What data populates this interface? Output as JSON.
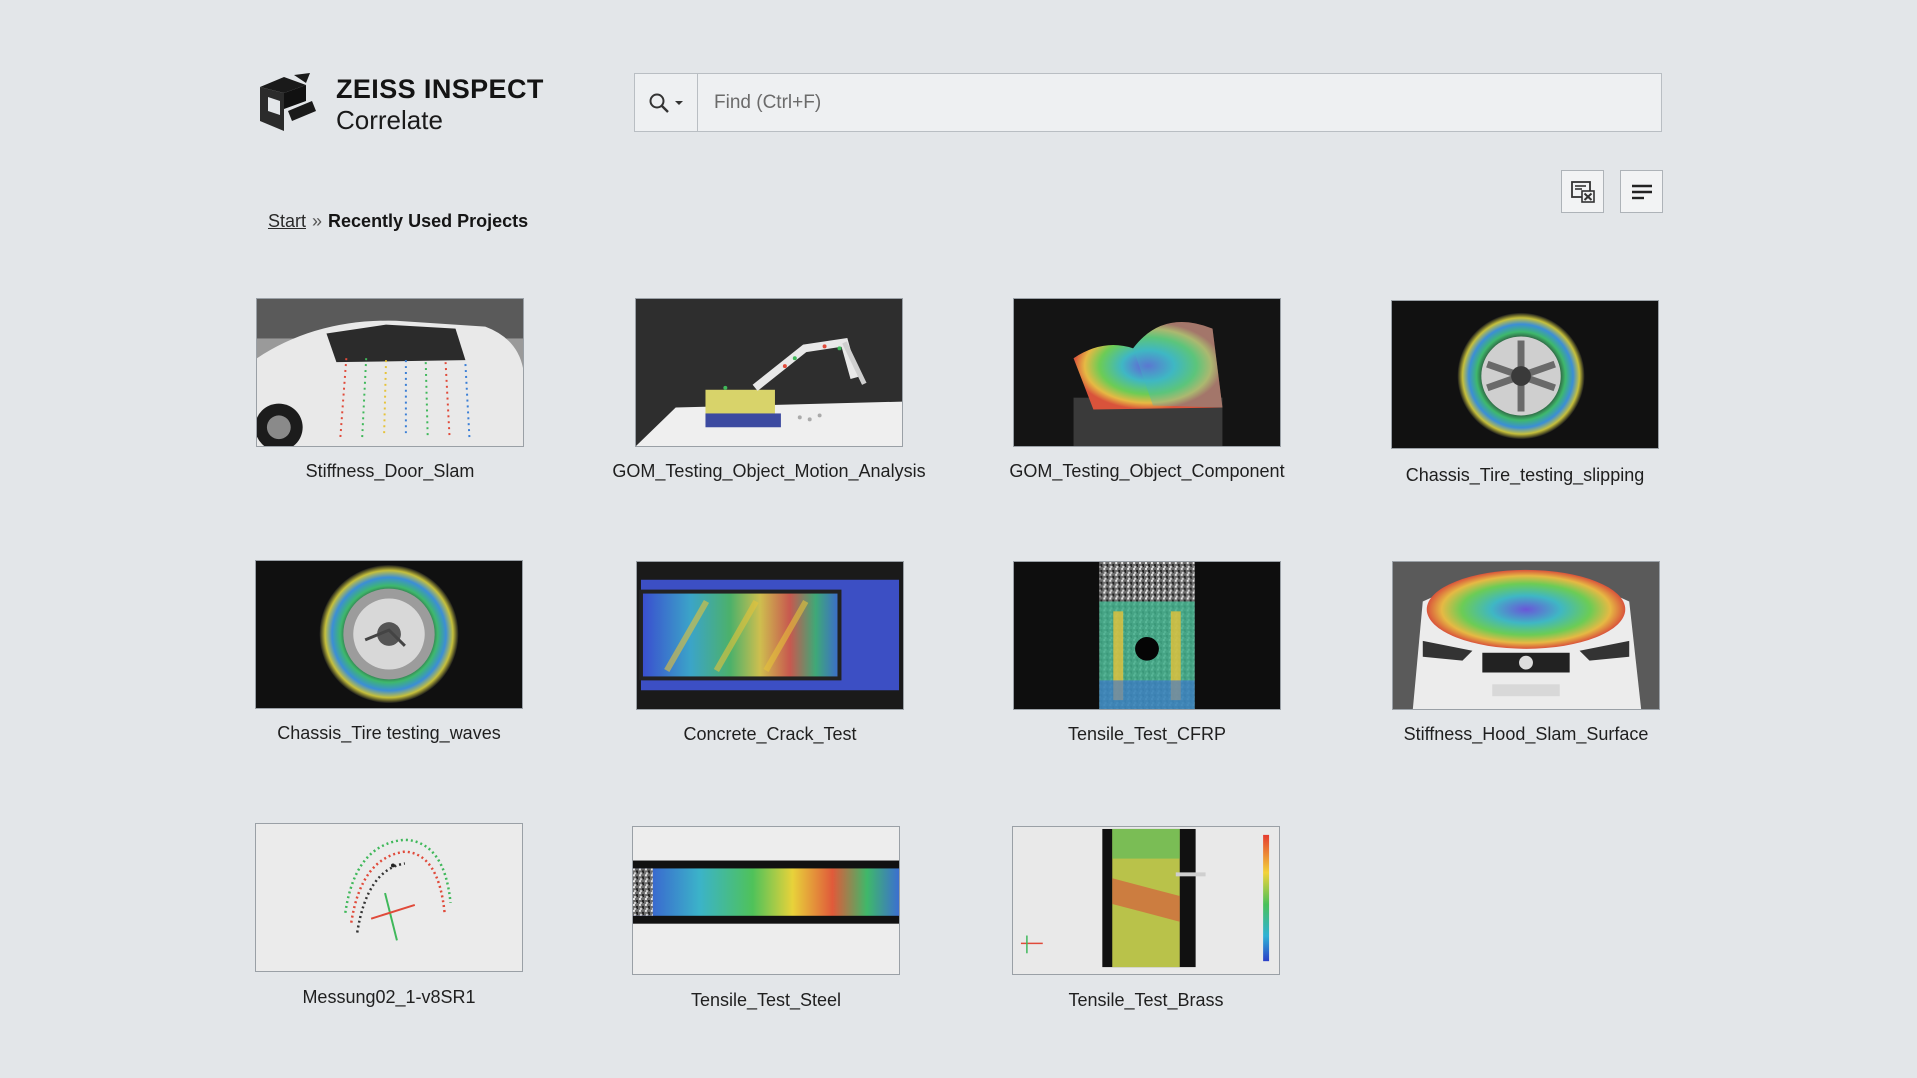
{
  "app": {
    "brand": "ZEISS INSPECT",
    "product": "Correlate"
  },
  "search": {
    "placeholder": "Find (Ctrl+F)",
    "value": "",
    "icon": "search-icon"
  },
  "toolbar": {
    "clear_icon": "clear-list-icon",
    "list_icon": "list-view-icon"
  },
  "breadcrumb": {
    "start": "Start",
    "separator": "»",
    "current": "Recently Used Projects"
  },
  "projects": [
    {
      "name": "Stiffness_Door_Slam"
    },
    {
      "name": "GOM_Testing_Object_Motion_Analysis"
    },
    {
      "name": "GOM_Testing_Object_Component"
    },
    {
      "name": "Chassis_Tire_testing_slipping"
    },
    {
      "name": "Chassis_Tire testing_waves"
    },
    {
      "name": "Concrete_Crack_Test"
    },
    {
      "name": "Tensile_Test_CFRP"
    },
    {
      "name": "Stiffness_Hood_Slam_Surface"
    },
    {
      "name": "Messung02_1-v8SR1"
    },
    {
      "name": "Tensile_Test_Steel"
    },
    {
      "name": "Tensile_Test_Brass"
    }
  ]
}
